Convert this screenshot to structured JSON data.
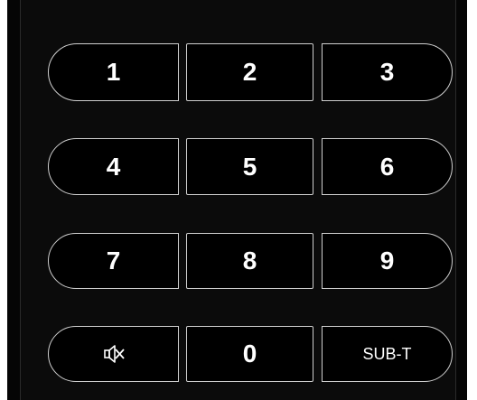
{
  "keypad": {
    "keys": [
      {
        "label": "1"
      },
      {
        "label": "2"
      },
      {
        "label": "3"
      },
      {
        "label": "4"
      },
      {
        "label": "5"
      },
      {
        "label": "6"
      },
      {
        "label": "7"
      },
      {
        "label": "8"
      },
      {
        "label": "9"
      },
      {
        "label": "",
        "icon": "mute-icon"
      },
      {
        "label": "0"
      },
      {
        "label": "SUB-T"
      }
    ]
  },
  "colors": {
    "body": "#0b0b0b",
    "key_border": "#cfcfcf",
    "key_text": "#ffffff"
  }
}
